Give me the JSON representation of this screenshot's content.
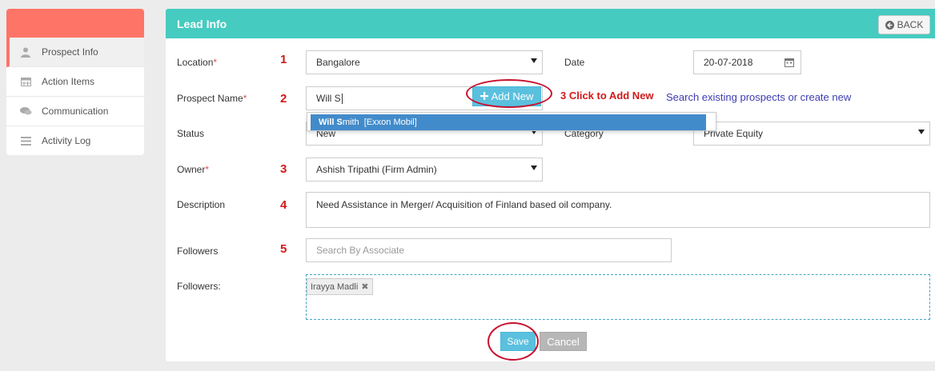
{
  "sidebar": {
    "items": [
      {
        "label": "Prospect Info",
        "icon": "user-icon",
        "active": true
      },
      {
        "label": "Action Items",
        "icon": "calendar-icon"
      },
      {
        "label": "Communication",
        "icon": "chat-icon"
      },
      {
        "label": "Activity Log",
        "icon": "list-icon"
      }
    ]
  },
  "panel": {
    "title": "Lead Info",
    "back_label": "BACK"
  },
  "form": {
    "location": {
      "label": "Location",
      "required": "*",
      "value": "Bangalore",
      "number": "1"
    },
    "date": {
      "label": "Date",
      "value": "20-07-2018"
    },
    "prospect": {
      "label": "Prospect Name",
      "required": "*",
      "value": "Will S",
      "number": "2",
      "add_new": "Add New"
    },
    "status": {
      "label": "Status",
      "value": "New"
    },
    "category": {
      "label": "Category",
      "value": "Private Equity"
    },
    "owner": {
      "label": "Owner",
      "required": "*",
      "value": "Ashish Tripathi (Firm Admin)",
      "number": "3"
    },
    "description": {
      "label": "Description",
      "value": "Need Assistance in Merger/ Acquisition of Finland based oil company.",
      "number": "4"
    },
    "followers_search": {
      "label": "Followers",
      "placeholder": "Search By Associate",
      "number": "5"
    },
    "followers_list": {
      "label": "Followers:",
      "tags": [
        "Irayya Madli"
      ]
    }
  },
  "autocomplete": {
    "match": "Will S",
    "rest": "mith",
    "company": "[Exxon Mobil]"
  },
  "annotations": {
    "click_to_add": "3 Click to Add New",
    "search_hint": "Search existing prospects or create new"
  },
  "buttons": {
    "save": "Save",
    "cancel": "Cancel"
  },
  "colors": {
    "header": "#45cbc0",
    "sidebar_accent": "#fe7466",
    "primary_button": "#5bc0de",
    "annotation_red": "#d11a1a",
    "annotation_blue": "#3b3bb3"
  }
}
